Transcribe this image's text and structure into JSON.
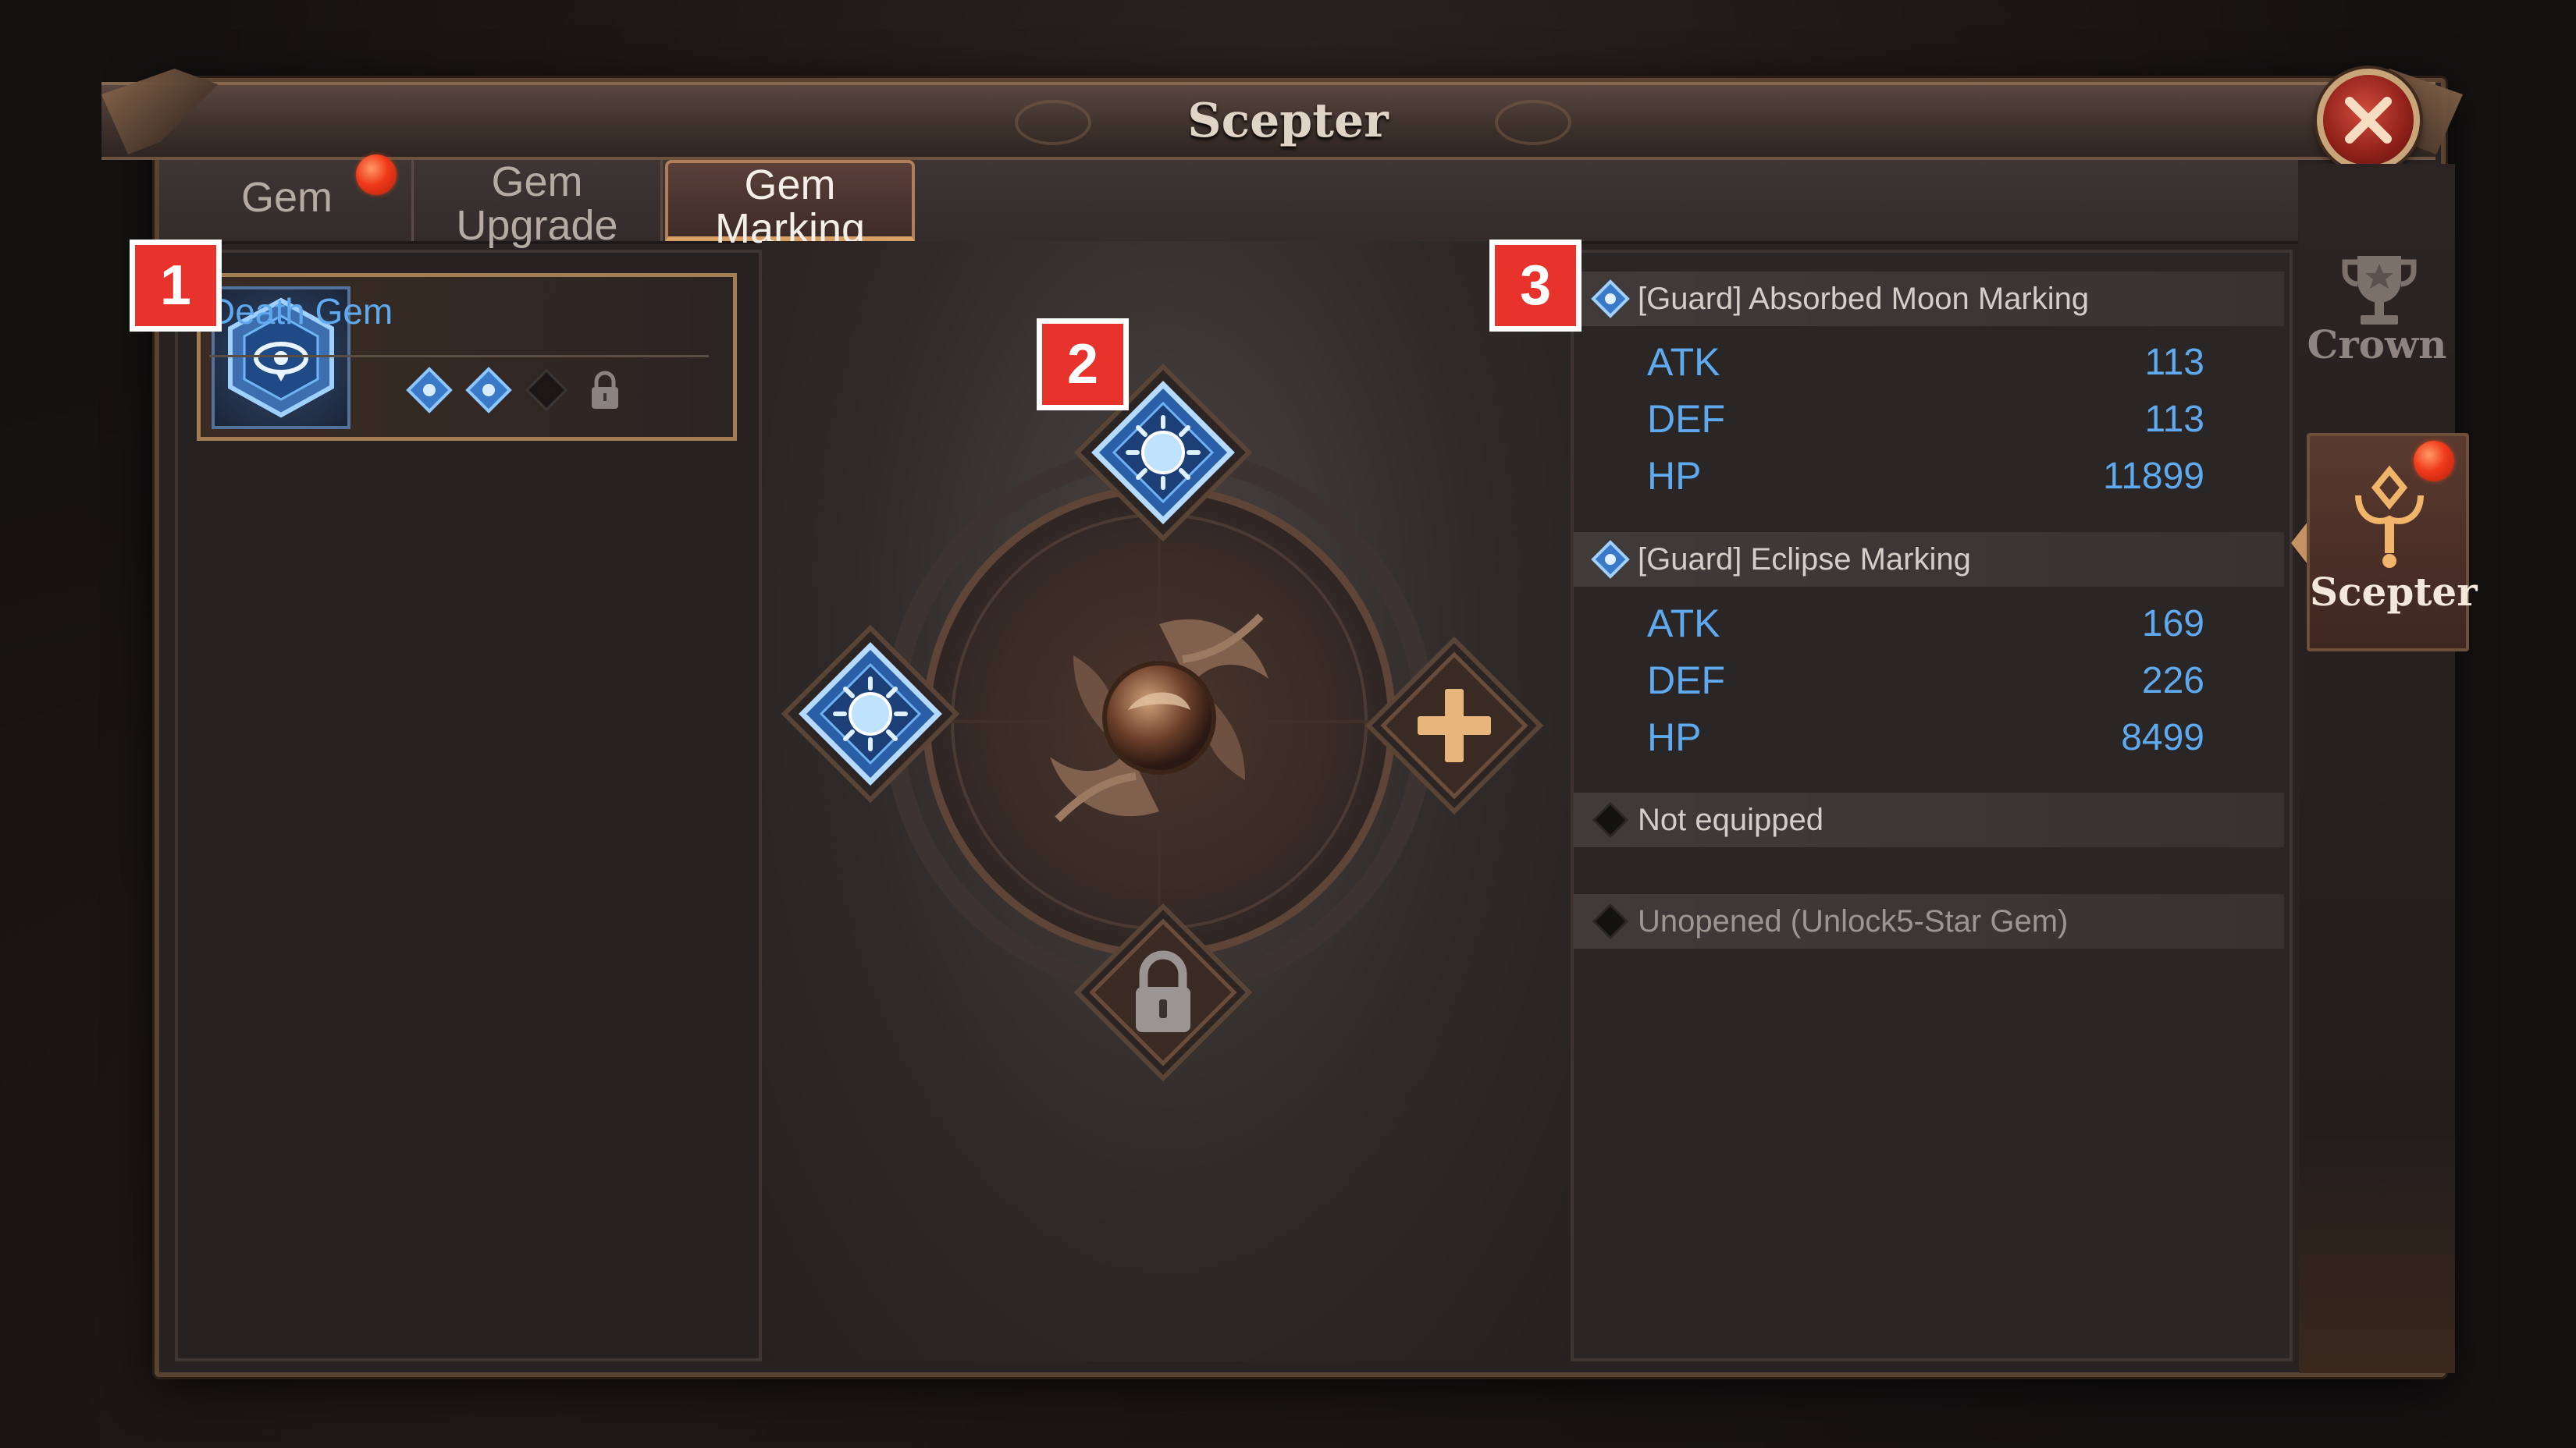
{
  "window": {
    "title": "Scepter",
    "close_icon": "close-x-icon"
  },
  "tabs": [
    {
      "label": "Gem",
      "active": false,
      "has_notification": true
    },
    {
      "label": "Gem\nUpgrade",
      "active": false,
      "has_notification": false
    },
    {
      "label": "Gem\nMarking",
      "active": true,
      "has_notification": false
    }
  ],
  "gem_list": {
    "items": [
      {
        "name": "Death Gem",
        "icon": "eye-hexagon-gem-icon",
        "slots": [
          "filled-blue",
          "filled-blue",
          "empty",
          "locked"
        ],
        "selected": true
      }
    ]
  },
  "marking_sockets": {
    "center_icon": "phoenix-emblem-icon",
    "top": {
      "state": "filled",
      "icon": "blue-sun-gem-icon"
    },
    "left": {
      "state": "filled",
      "icon": "blue-sun-gem-icon"
    },
    "right": {
      "state": "add",
      "icon": "plus-icon"
    },
    "bottom": {
      "state": "locked",
      "icon": "lock-icon"
    }
  },
  "stat_groups": [
    {
      "title": "[Guard] Absorbed Moon Marking",
      "stats": [
        {
          "label": "ATK",
          "value": "113"
        },
        {
          "label": "DEF",
          "value": "113"
        },
        {
          "label": "HP",
          "value": "11899"
        }
      ]
    },
    {
      "title": "[Guard] Eclipse Marking",
      "stats": [
        {
          "label": "ATK",
          "value": "169"
        },
        {
          "label": "DEF",
          "value": "226"
        },
        {
          "label": "HP",
          "value": "8499"
        }
      ]
    },
    {
      "title": "Not equipped",
      "stats": []
    },
    {
      "title": "Unopened (Unlock5-Star Gem)",
      "stats": []
    }
  ],
  "side_nav": [
    {
      "label": "Crown",
      "icon": "trophy-icon",
      "active": false,
      "has_notification": false
    },
    {
      "label": "Scepter",
      "icon": "scepter-icon",
      "active": true,
      "has_notification": true
    }
  ],
  "callouts": [
    "1",
    "2",
    "3"
  ],
  "colors": {
    "accent_blue": "#5fa9ef",
    "notification_red": "#f03a1a",
    "callout_red": "#e8322c",
    "frame_bronze": "#a57d52"
  }
}
